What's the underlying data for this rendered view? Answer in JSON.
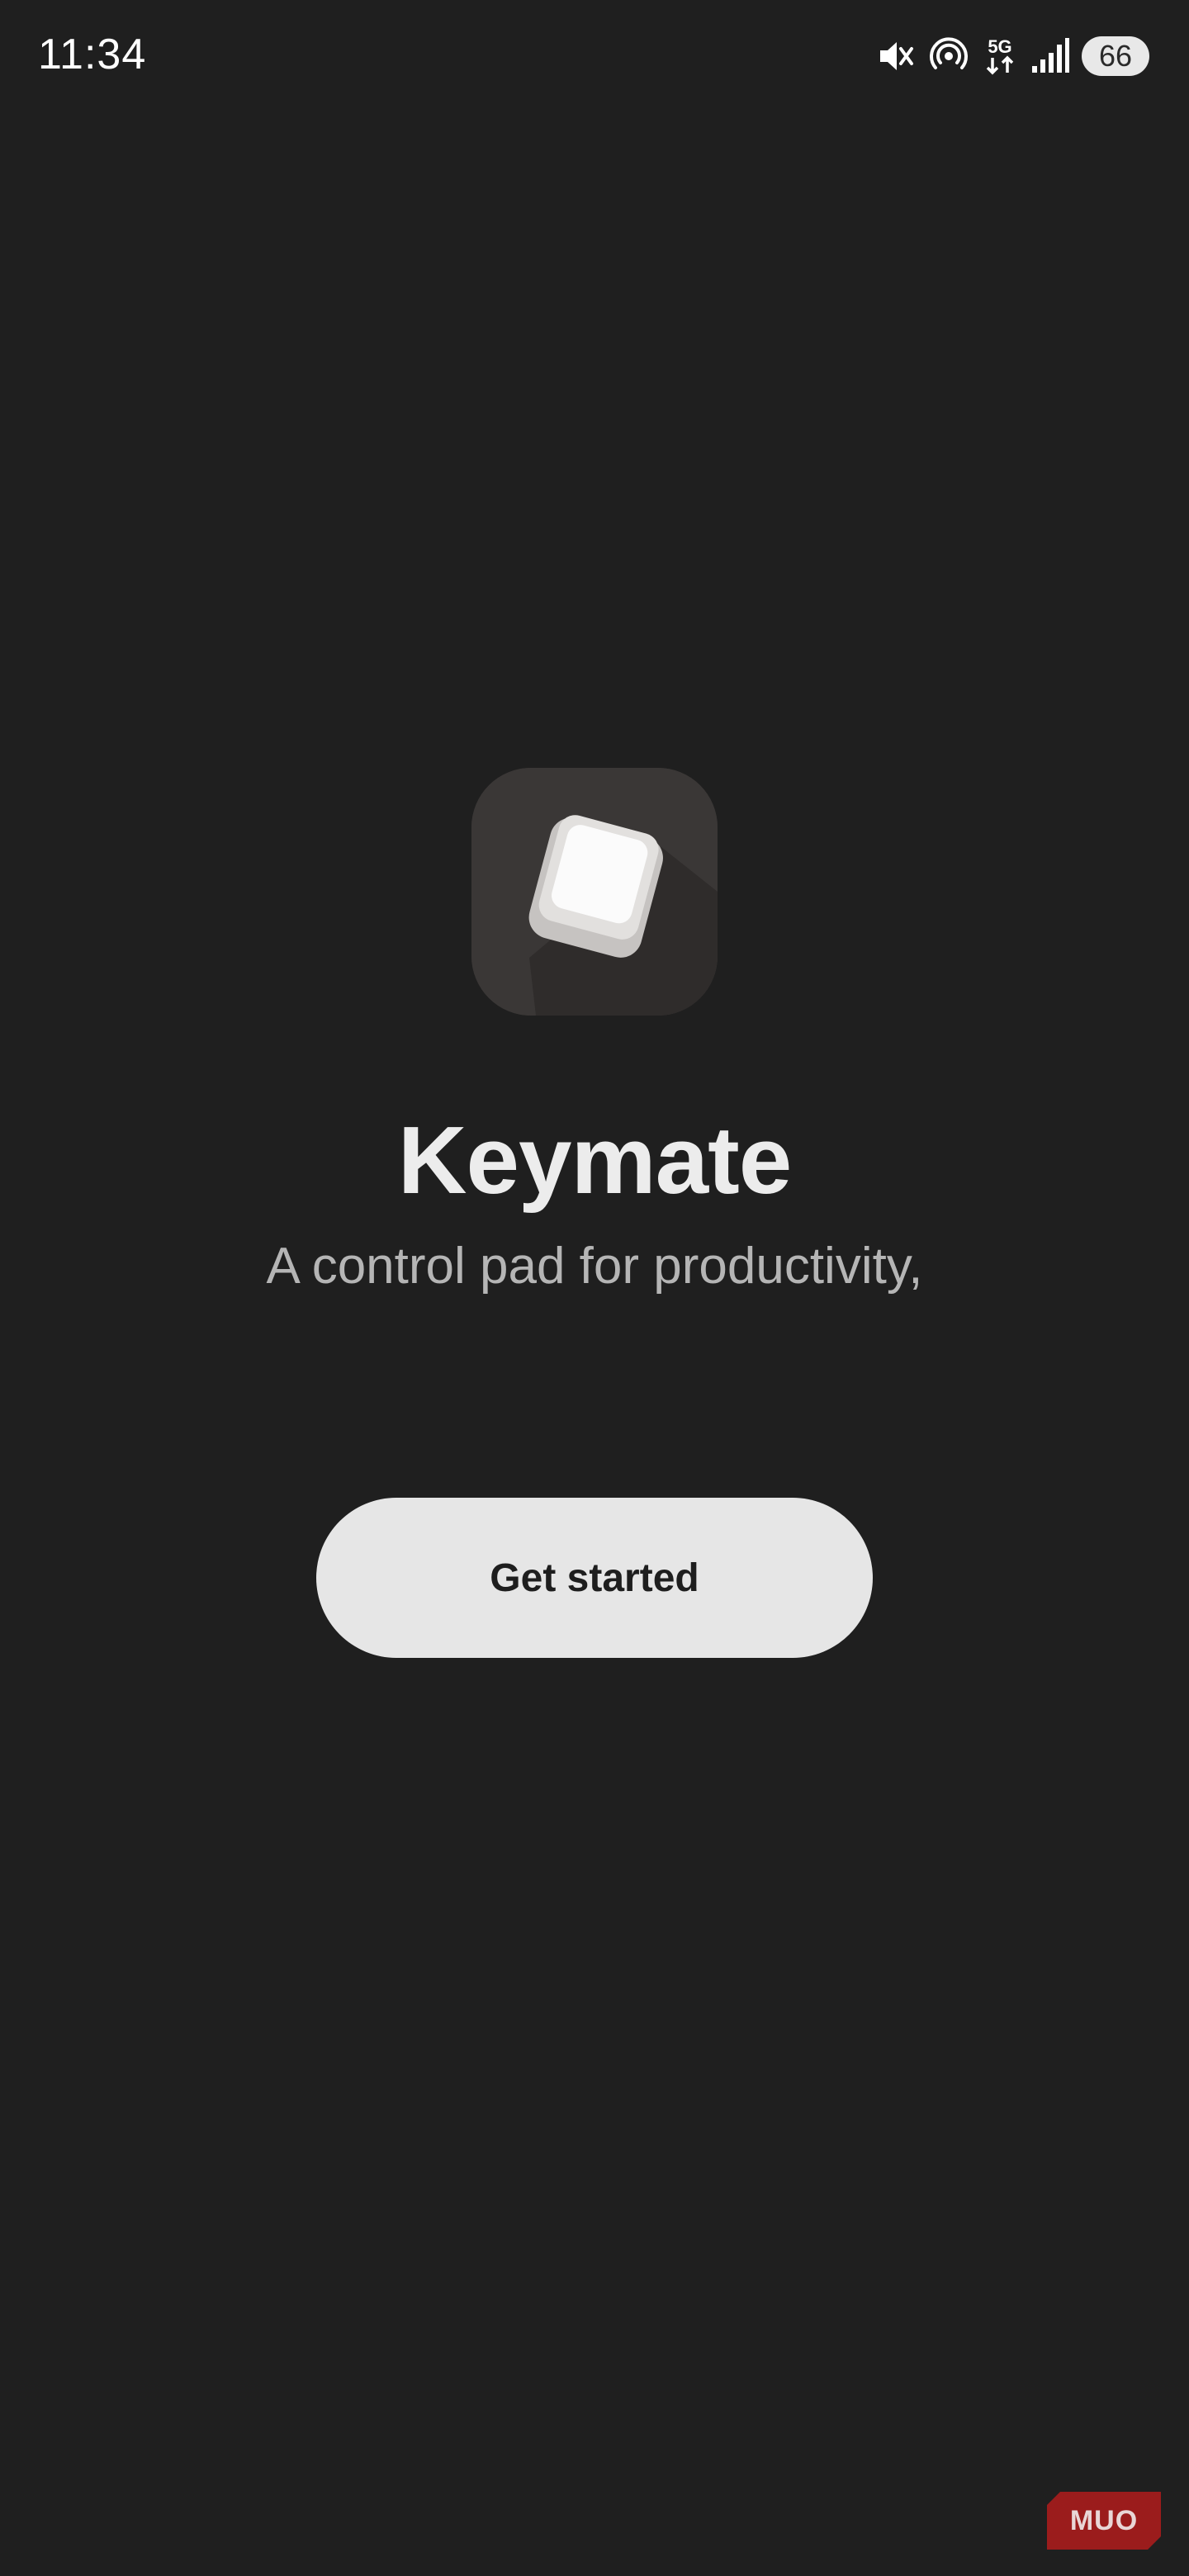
{
  "status_bar": {
    "time": "11:34",
    "battery_level": "66",
    "icons": [
      "mute-icon",
      "hotspot-icon",
      "5g-icon",
      "signal-icon",
      "battery-icon"
    ]
  },
  "app": {
    "icon": "keycap-icon",
    "name": "Keymate",
    "tagline": "A control pad for productivity,"
  },
  "actions": {
    "get_started_label": "Get started"
  },
  "watermark": {
    "text": "MUO"
  },
  "colors": {
    "background": "#1f1f1f",
    "button_background": "#e6e6e6",
    "watermark_red": "#9b1c1c"
  }
}
